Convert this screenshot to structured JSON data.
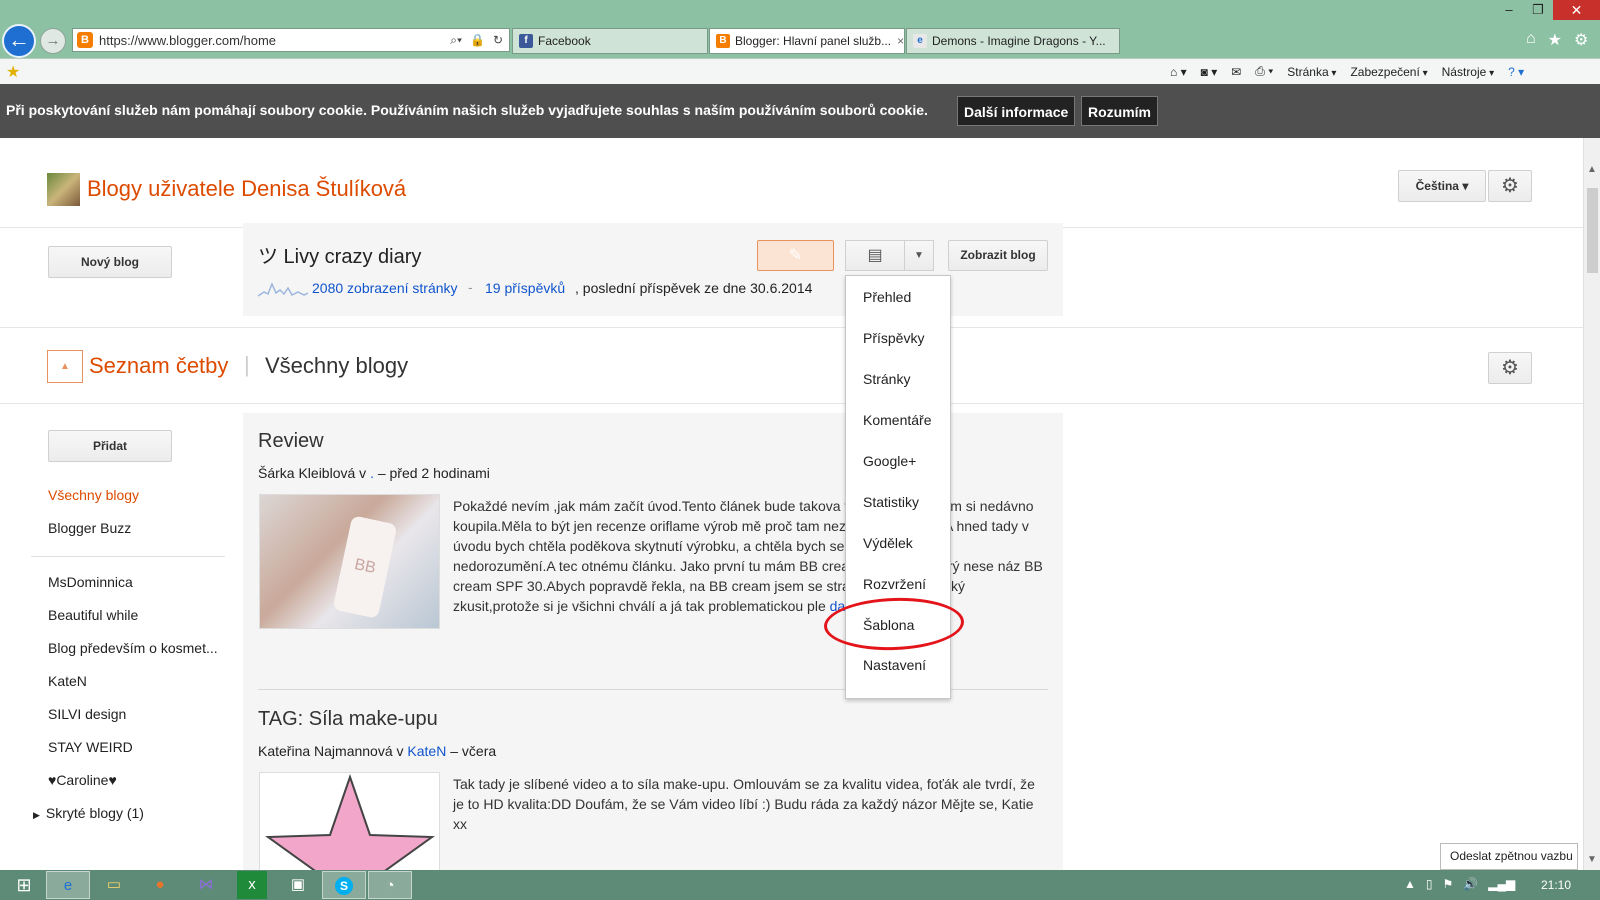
{
  "browser": {
    "url": "https://www.blogger.com/home",
    "tabs": [
      {
        "label": "Facebook",
        "active": false
      },
      {
        "label": "Blogger: Hlavní panel služb...",
        "active": true
      },
      {
        "label": "Demons - Imagine Dragons - Y...",
        "active": false
      }
    ],
    "cmd": {
      "page": "Stránka",
      "security": "Zabezpečení",
      "tools": "Nástroje"
    }
  },
  "cookie": {
    "text": "Při poskytování služeb nám pomáhají soubory cookie. Používáním našich služeb vyjadřujete souhlas s naším používáním souborů cookie.",
    "more": "Další informace",
    "ok": "Rozumím"
  },
  "header": {
    "title": "Blogy uživatele Denisa Štulíková",
    "language": "Čeština"
  },
  "blog": {
    "new_blog": "Nový blog",
    "name": "ツ Livy crazy diary",
    "views": "2080 zobrazení stránky",
    "sep": "-",
    "posts": "19 příspěvků",
    "last_post": ", poslední příspěvek ze dne 30.6.2014",
    "view_blog": "Zobrazit blog"
  },
  "menu": {
    "items": [
      "Přehled",
      "Příspěvky",
      "Stránky",
      "Komentáře",
      "Google+",
      "Statistiky",
      "Výdělek",
      "Rozvržení",
      "Šablona",
      "Nastavení"
    ],
    "highlighted": "Šablona"
  },
  "reading": {
    "title": "Seznam četby",
    "pipe": "|",
    "subtitle": "Všechny blogy",
    "add": "Přidat"
  },
  "sidebar": {
    "items": [
      "Všechny blogy",
      "Blogger Buzz",
      "MsDominnica",
      "Beautiful while",
      "Blog především o kosmet...",
      "KateN",
      "SILVI design",
      "STAY WEIRD",
      "♥Caroline♥",
      "Skryté blogy (1)"
    ]
  },
  "posts": [
    {
      "title": "Review",
      "author": "Šárka Kleiblová v",
      "source": ".",
      "time": "– před 2 hodinami",
      "text": "Pokaždé nevím ,jak mám začít úvod.Tento článek bude takova výrobků,které jsem si nedávno koupila.Měla to být jen recenze oriflame výrob mě proč tam nezařadit více věcí.A hned tady v úvodu bych chtěla poděkova skytnutí výrobku, a chtěla bych se omluvit za malé nedorozumění.A tec otnému článku. Jako první tu mám BB cream z oriflamu,který nese náz BB cream SPF 30.Abych popravdě řekla, na BB cream jsem se strašně těšila a nějaký zkusit,protože si je všichni chválí a já tak problematickou ple",
      "more": "další »"
    },
    {
      "title": "TAG: Síla make-upu",
      "author": "Kateřina Najmannová v",
      "source": "KateN",
      "time": "– včera",
      "text": "Tak tady je slíbené video a to síla make-upu. Omlouvám se za kvalitu videa, foťák ale tvrdí, že je to HD kvalita:DD Doufám, že se Vám video líbí :) Budu ráda za každý názor Mějte se, Katie xx"
    }
  ],
  "feedback": "Odeslat zpětnou vazbu",
  "taskbar": {
    "clock": "21:10"
  },
  "colors": {
    "accent": "#dd4b00",
    "link": "#1155cc",
    "highlight_ring": "#e3141a"
  }
}
